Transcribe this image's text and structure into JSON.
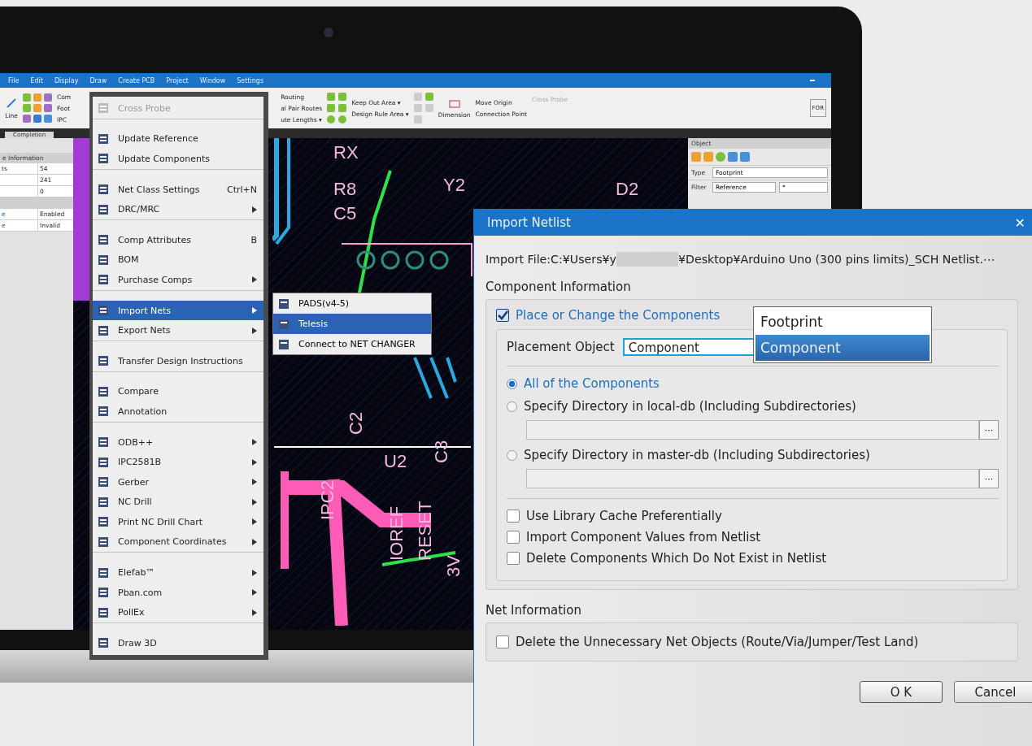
{
  "menu_bar": [
    {
      "label": "File"
    },
    {
      "label": "Edit"
    },
    {
      "label": "Display"
    },
    {
      "label": "Draw"
    },
    {
      "label": "Create PCB"
    },
    {
      "label": "Project"
    },
    {
      "label": "Window"
    },
    {
      "label": "Settings"
    }
  ],
  "ribbon": {
    "line_label": "Line",
    "cut_labels": [
      "Com",
      "Foot",
      "IPC"
    ],
    "route_labels": [
      "Routing",
      "al Pair Routes",
      "ute Lengths ▾"
    ],
    "area_labels": [
      "Keep Out Area ▾",
      "Design Rule Area ▾"
    ],
    "dimension": "Dimension",
    "origin_labels": [
      "Move Origin",
      "Connection Point"
    ],
    "cross_probe": "Cross Probe",
    "right_cut": "FOR",
    "tab": "Completion"
  },
  "left_panel": {
    "header": "e Information",
    "rows": [
      {
        "label": "ts",
        "value": "54"
      },
      {
        "label": "",
        "value": "241"
      },
      {
        "label": "",
        "value": "0"
      }
    ],
    "settings": [
      {
        "label": "e",
        "value": "Enabled"
      },
      {
        "label": "e",
        "value": "Invalid"
      }
    ]
  },
  "board_labels": [
    "RX",
    "R8",
    "C5",
    "Y2",
    "D2",
    "U2",
    "C3",
    "C2",
    "IPC2",
    "IOREF",
    "RESET",
    "3V"
  ],
  "object_panel": {
    "title": "Object",
    "type_label": "Type",
    "type_value": "Footprint",
    "filter_label": "Filter",
    "filter_value": "Reference",
    "filter_text": "*"
  },
  "context_menu": [
    {
      "label": "Cross Probe",
      "disabled": true,
      "selected": false,
      "submenu": false,
      "separator_after": true
    },
    {
      "label": "Update Reference",
      "disabled": false,
      "selected": false,
      "submenu": false
    },
    {
      "label": "Update Components",
      "disabled": false,
      "selected": false,
      "submenu": false,
      "separator_after": true
    },
    {
      "label": "Net Class Settings",
      "shortcut": "Ctrl+N",
      "disabled": false,
      "selected": false,
      "submenu": false
    },
    {
      "label": "DRC/MRC",
      "disabled": false,
      "selected": false,
      "submenu": true,
      "separator_after": true
    },
    {
      "label": "Comp Attributes",
      "shortcut": "B",
      "disabled": false,
      "selected": false,
      "submenu": false
    },
    {
      "label": "BOM",
      "disabled": false,
      "selected": false,
      "submenu": false
    },
    {
      "label": "Purchase Comps",
      "disabled": false,
      "selected": false,
      "submenu": true,
      "separator_after": true
    },
    {
      "label": "Import Nets",
      "disabled": false,
      "selected": true,
      "submenu": true
    },
    {
      "label": "Export Nets",
      "disabled": false,
      "selected": false,
      "submenu": true,
      "separator_after": true
    },
    {
      "label": "Transfer Design Instructions",
      "disabled": false,
      "selected": false,
      "submenu": false,
      "separator_after": true
    },
    {
      "label": "Compare",
      "disabled": false,
      "selected": false,
      "submenu": false
    },
    {
      "label": "Annotation",
      "disabled": false,
      "selected": false,
      "submenu": false,
      "separator_after": true
    },
    {
      "label": "ODB++",
      "disabled": false,
      "selected": false,
      "submenu": true
    },
    {
      "label": "IPC2581B",
      "disabled": false,
      "selected": false,
      "submenu": true
    },
    {
      "label": "Gerber",
      "disabled": false,
      "selected": false,
      "submenu": true
    },
    {
      "label": "NC Drill",
      "disabled": false,
      "selected": false,
      "submenu": true
    },
    {
      "label": "Print NC Drill Chart",
      "disabled": false,
      "selected": false,
      "submenu": true
    },
    {
      "label": "Component Coordinates",
      "disabled": false,
      "selected": false,
      "submenu": true,
      "separator_after": true
    },
    {
      "label": "Elefab™",
      "disabled": false,
      "selected": false,
      "submenu": true
    },
    {
      "label": "Pban.com",
      "disabled": false,
      "selected": false,
      "submenu": true
    },
    {
      "label": "PollEx",
      "disabled": false,
      "selected": false,
      "submenu": true,
      "separator_after": true
    },
    {
      "label": "Draw 3D",
      "disabled": false,
      "selected": false,
      "submenu": false
    }
  ],
  "submenu": [
    {
      "label": "PADS(v4-5)",
      "selected": false
    },
    {
      "label": "Telesis",
      "selected": true
    },
    {
      "label": "Connect to NET CHANGER",
      "selected": false
    }
  ],
  "dialog": {
    "title": "Import Netlist",
    "close": "✕",
    "file_prefix": "Import File:C:¥Users¥y",
    "file_suffix": "¥Desktop¥Arduino Uno (300 pins limits)_SCH Netlist.⋯",
    "component_section": "Component Information",
    "place_label": "Place or Change the Components",
    "place_checked": true,
    "placement_label": "Placement Object",
    "placement_value": "Component",
    "dropdown_options": [
      {
        "label": "Footprint",
        "selected": false
      },
      {
        "label": "Component",
        "selected": true
      }
    ],
    "scope_options": [
      {
        "label": "All of the Components",
        "selected": true,
        "has_path": false
      },
      {
        "label": "Specify Directory in local-db (Including Subdirectories)",
        "selected": false,
        "has_path": true,
        "browse": "···"
      },
      {
        "label": "Specify Directory in master-db (Including Subdirectories)",
        "selected": false,
        "has_path": true,
        "browse": "···"
      }
    ],
    "options": [
      {
        "label": "Use Library Cache Preferentially",
        "checked": false
      },
      {
        "label": "Import Component Values from Netlist",
        "checked": false
      },
      {
        "label": "Delete Components Which Do Not Exist in Netlist",
        "checked": false
      }
    ],
    "net_section": "Net Information",
    "net_options": [
      {
        "label": "Delete the Unnecessary Net Objects (Route/Via/Jumper/Test Land)",
        "checked": false
      }
    ],
    "buttons": [
      {
        "label": "O K",
        "kind": "ok"
      },
      {
        "label": "Cancel",
        "kind": "cancel"
      }
    ]
  }
}
